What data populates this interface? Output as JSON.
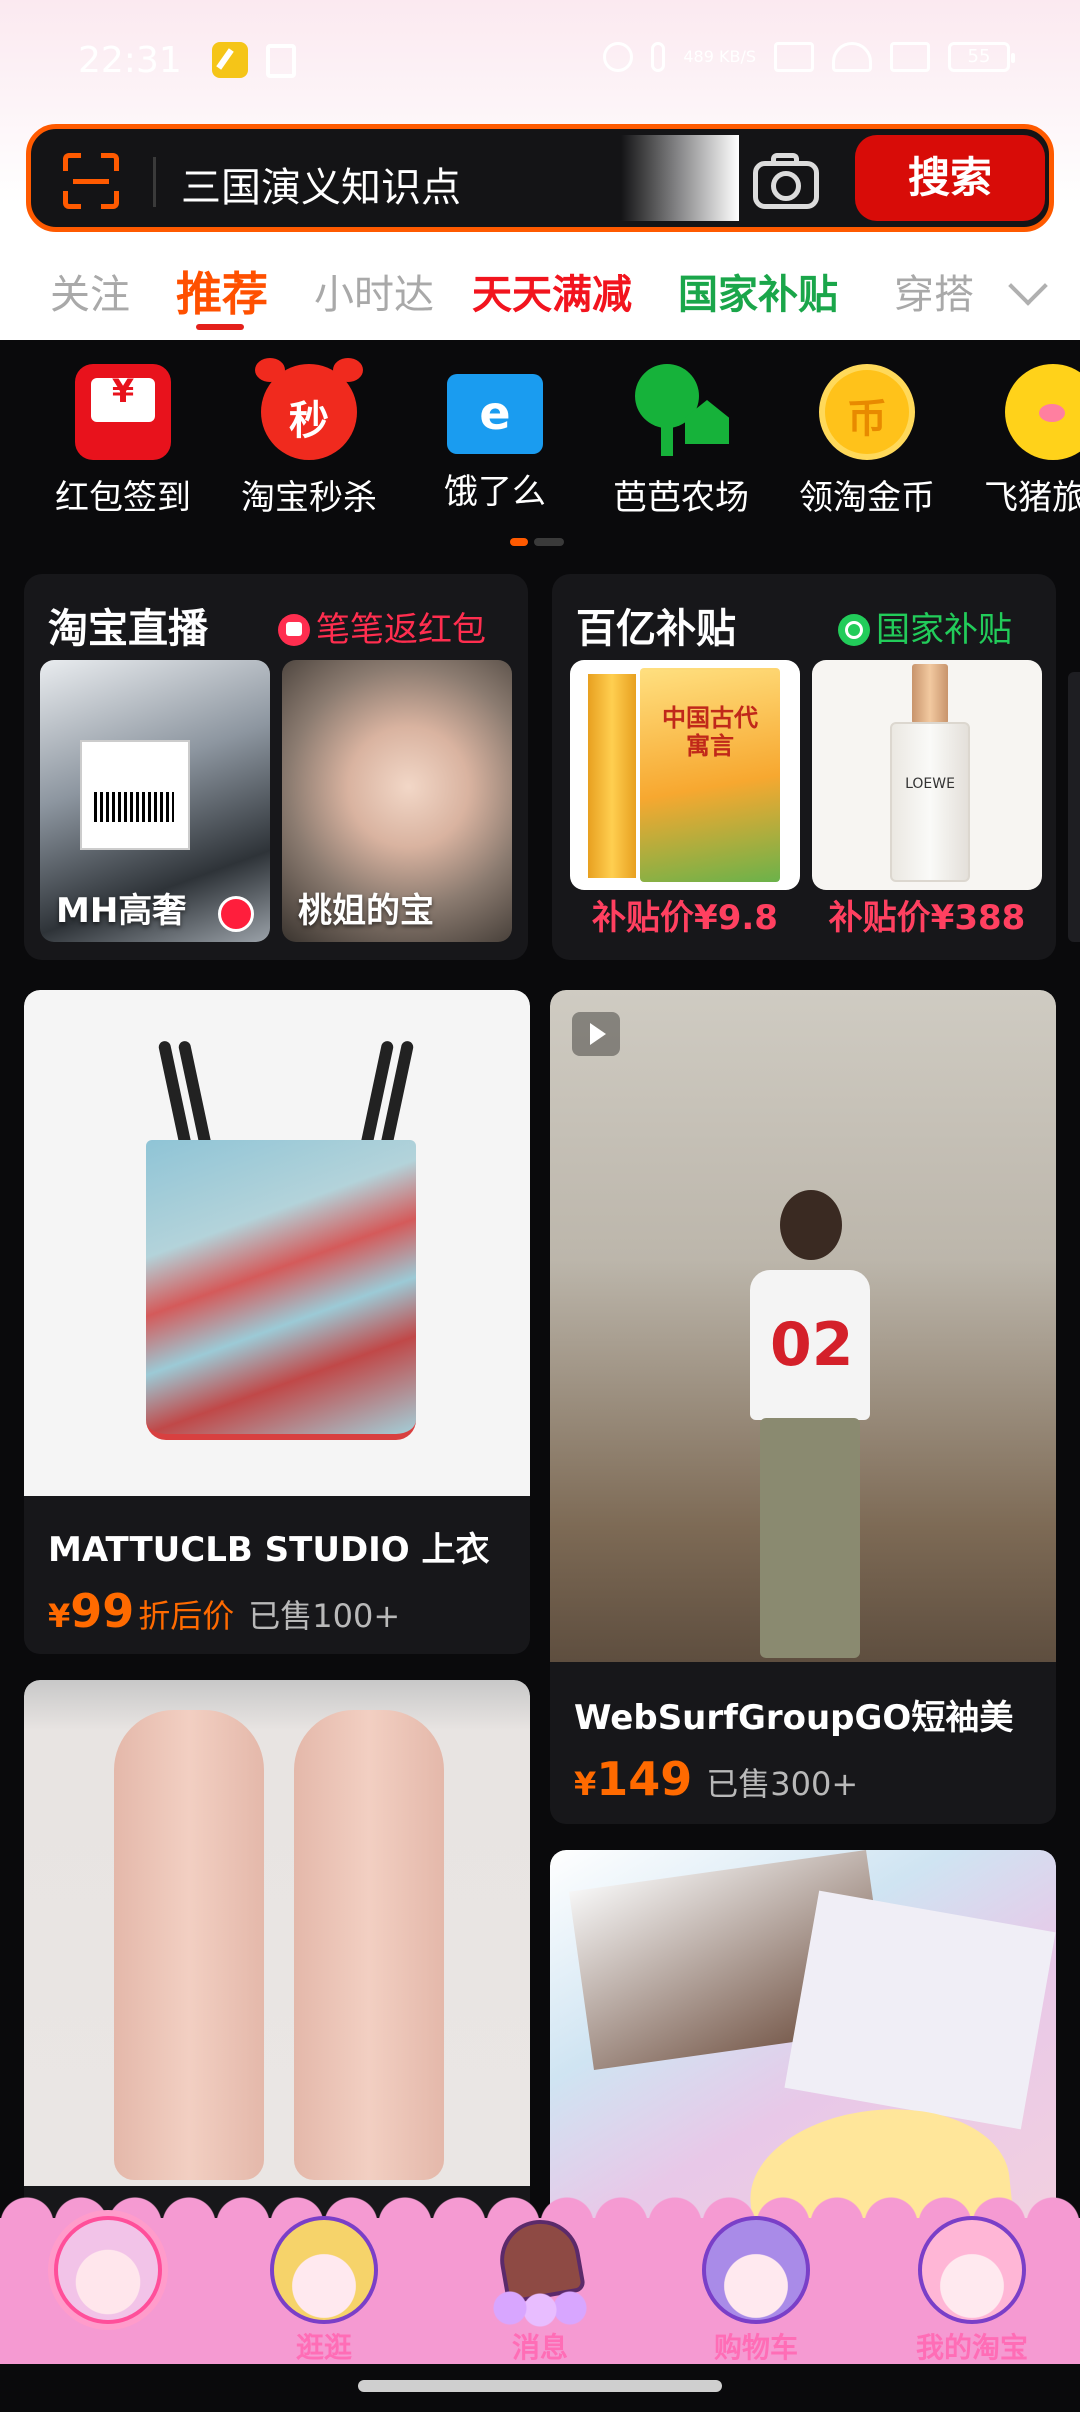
{
  "status_bar": {
    "time": "22:31",
    "net_speed": "489 KB/S",
    "battery": "55"
  },
  "search": {
    "query": "三国演义知识点",
    "button_label": "搜索"
  },
  "tabs": [
    {
      "label": "关注"
    },
    {
      "label": "推荐"
    },
    {
      "label": "小时达"
    },
    {
      "label": "天天满减"
    },
    {
      "label": "国家补贴"
    },
    {
      "label": "穿搭"
    }
  ],
  "shortcuts": [
    {
      "label": "红包签到",
      "glyph": "¥"
    },
    {
      "label": "淘宝秒杀",
      "glyph": "秒"
    },
    {
      "label": "饿了么",
      "glyph": "e"
    },
    {
      "label": "芭芭农场"
    },
    {
      "label": "领淘金币",
      "glyph": "币"
    },
    {
      "label": "飞猪旅"
    }
  ],
  "promo_live": {
    "title": "淘宝直播",
    "tag": "笔笔返红包",
    "items": [
      {
        "caption": "MH高奢"
      },
      {
        "caption": "桃姐的宝"
      }
    ]
  },
  "promo_subsidy": {
    "title": "百亿补贴",
    "tag": "国家补贴",
    "items": [
      {
        "price": "补贴价¥9.8",
        "book_title": "中国古代寓言"
      },
      {
        "price": "补贴价¥388",
        "brand": "LOEWE"
      }
    ]
  },
  "feed": [
    {
      "title": "MATTUCLB STUDIO 上衣",
      "currency": "¥",
      "price": "99",
      "price_note": "折后价",
      "sold": "已售100+"
    },
    {
      "title": "WebSurfGroupGO短袖美",
      "currency": "¥",
      "price": "149",
      "sold": "已售300+",
      "jersey_number": "02"
    },
    {
      "title": ""
    },
    {
      "title": ""
    }
  ],
  "bottom_nav": [
    {
      "label": ""
    },
    {
      "label": "逛逛"
    },
    {
      "label": "消息"
    },
    {
      "label": "购物车"
    },
    {
      "label": "我的淘宝"
    }
  ],
  "colors": {
    "accent": "#ff5000",
    "search_button": "#d80c08",
    "price": "#ff6a00",
    "nav_bg": "#f59ad2"
  }
}
